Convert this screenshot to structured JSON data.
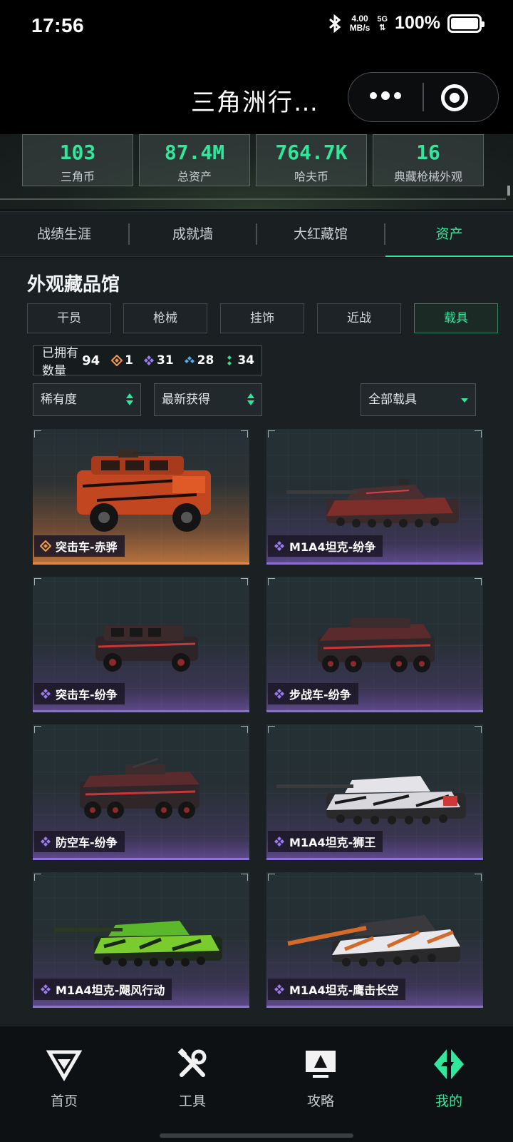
{
  "status_bar": {
    "time": "17:56",
    "net_speed_value": "4.00",
    "net_speed_unit": "MB/s",
    "network": "5G",
    "battery": "100%"
  },
  "title_bar": {
    "title": "三角洲行…"
  },
  "stats": [
    {
      "value": "103",
      "label": "三角币"
    },
    {
      "value": "87.4M",
      "label": "总资产"
    },
    {
      "value": "764.7K",
      "label": "哈夫币"
    },
    {
      "value": "16",
      "label": "典藏枪械外观"
    }
  ],
  "tabs": [
    {
      "label": "战绩生涯",
      "active": false
    },
    {
      "label": "成就墙",
      "active": false
    },
    {
      "label": "大红藏馆",
      "active": false
    },
    {
      "label": "资产",
      "active": true
    }
  ],
  "section": {
    "title": "外观藏品馆"
  },
  "categories": [
    {
      "label": "干员",
      "active": false
    },
    {
      "label": "枪械",
      "active": false
    },
    {
      "label": "挂饰",
      "active": false
    },
    {
      "label": "近战",
      "active": false
    },
    {
      "label": "载具",
      "active": true
    }
  ],
  "owned": {
    "label": "已拥有数量",
    "total": "94",
    "rarities": [
      {
        "icon": "orange-diamond-icon",
        "color": "#e8944a",
        "count": "1"
      },
      {
        "icon": "purple-diamond-icon",
        "color": "#9b7cf0",
        "count": "31"
      },
      {
        "icon": "blue-diamond-icon",
        "color": "#58a6e8",
        "count": "28"
      },
      {
        "icon": "green-diamond-icon",
        "color": "#3fd98c",
        "count": "34"
      }
    ]
  },
  "filters": {
    "rarity_sort": "稀有度",
    "time_sort": "最新获得",
    "vehicle_type": "全部载具"
  },
  "vehicles": [
    {
      "name": "突击车-赤骅",
      "rarity": "orange",
      "icon": "orange-diamond-icon"
    },
    {
      "name": "M1A4坦克-纷争",
      "rarity": "purple",
      "icon": "purple-diamond-icon"
    },
    {
      "name": "突击车-纷争",
      "rarity": "purple",
      "icon": "purple-diamond-icon"
    },
    {
      "name": "步战车-纷争",
      "rarity": "purple",
      "icon": "purple-diamond-icon"
    },
    {
      "name": "防空车-纷争",
      "rarity": "purple",
      "icon": "purple-diamond-icon"
    },
    {
      "name": "M1A4坦克-狮王",
      "rarity": "purple",
      "icon": "purple-diamond-icon"
    },
    {
      "name": "M1A4坦克-飓风行动",
      "rarity": "purple",
      "icon": "purple-diamond-icon"
    },
    {
      "name": "M1A4坦克-鹰击长空",
      "rarity": "purple",
      "icon": "purple-diamond-icon"
    }
  ],
  "colors": {
    "accent": "#2fe89c",
    "legendary": "#e8944a",
    "epic": "#9b7cf0"
  },
  "bottom_nav": [
    {
      "label": "首页",
      "icon": "delta-logo-icon",
      "active": false
    },
    {
      "label": "工具",
      "icon": "tools-icon",
      "active": false
    },
    {
      "label": "攻略",
      "icon": "monitor-guide-icon",
      "active": false
    },
    {
      "label": "我的",
      "icon": "profile-logo-icon",
      "active": true
    }
  ]
}
